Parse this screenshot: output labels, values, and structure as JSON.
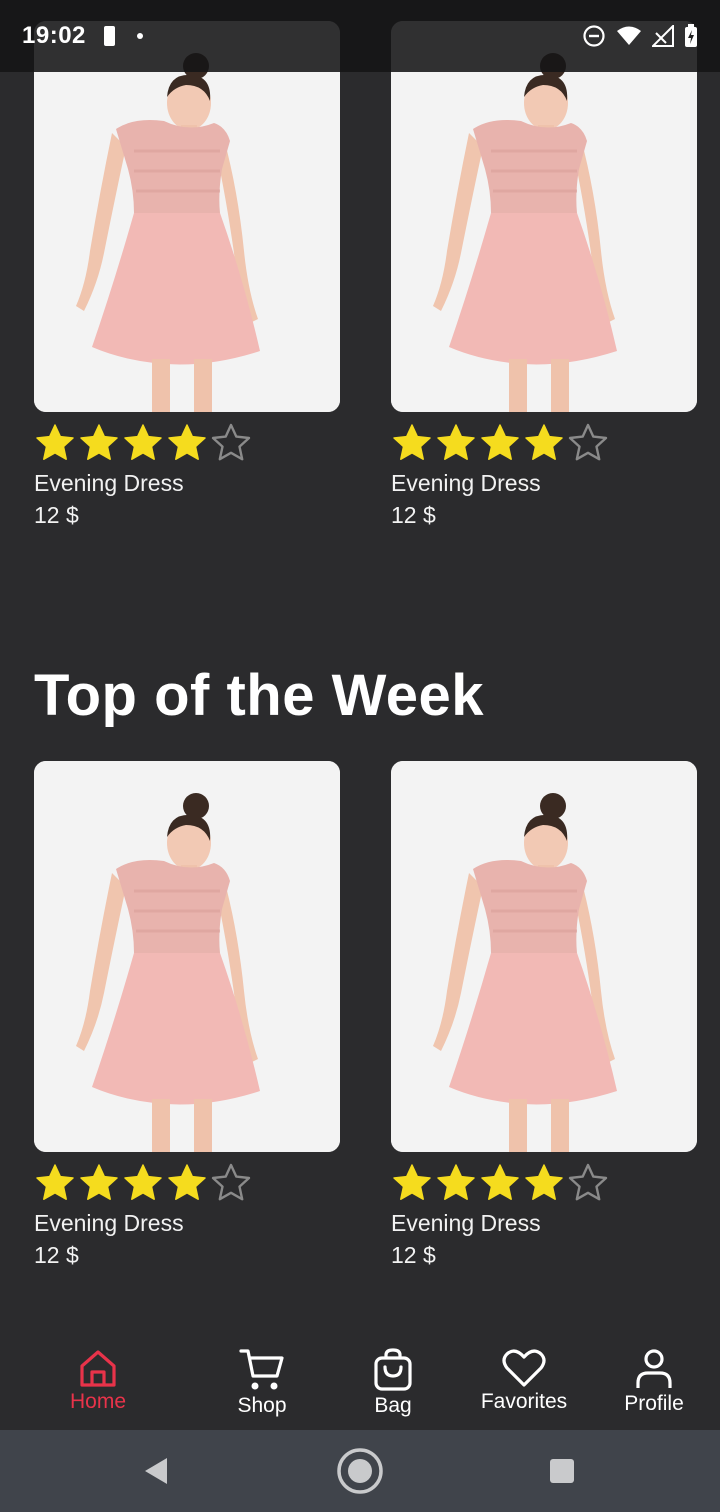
{
  "status_bar": {
    "time": "19:02"
  },
  "sections": [
    {
      "title": "",
      "products": [
        {
          "name": "Evening Dress",
          "price": "12 $",
          "rating": 4,
          "max_rating": 5
        },
        {
          "name": "Evening Dress",
          "price": "12 $",
          "rating": 4,
          "max_rating": 5
        }
      ]
    },
    {
      "title": "Top of the Week",
      "products": [
        {
          "name": "Evening Dress",
          "price": "12 $",
          "rating": 4,
          "max_rating": 5
        },
        {
          "name": "Evening Dress",
          "price": "12 $",
          "rating": 4,
          "max_rating": 5
        }
      ]
    }
  ],
  "bottom_nav": {
    "items": [
      {
        "label": "Home",
        "icon": "home-icon",
        "active": true
      },
      {
        "label": "Shop",
        "icon": "cart-icon",
        "active": false
      },
      {
        "label": "Bag",
        "icon": "bag-icon",
        "active": false
      },
      {
        "label": "Favorites",
        "icon": "heart-icon",
        "active": false
      },
      {
        "label": "Profile",
        "icon": "profile-icon",
        "active": false
      }
    ]
  },
  "colors": {
    "background": "#2b2b2d",
    "accent": "#e8334a",
    "star_filled": "#f5dc1e",
    "star_empty": "#8a8a8a"
  }
}
